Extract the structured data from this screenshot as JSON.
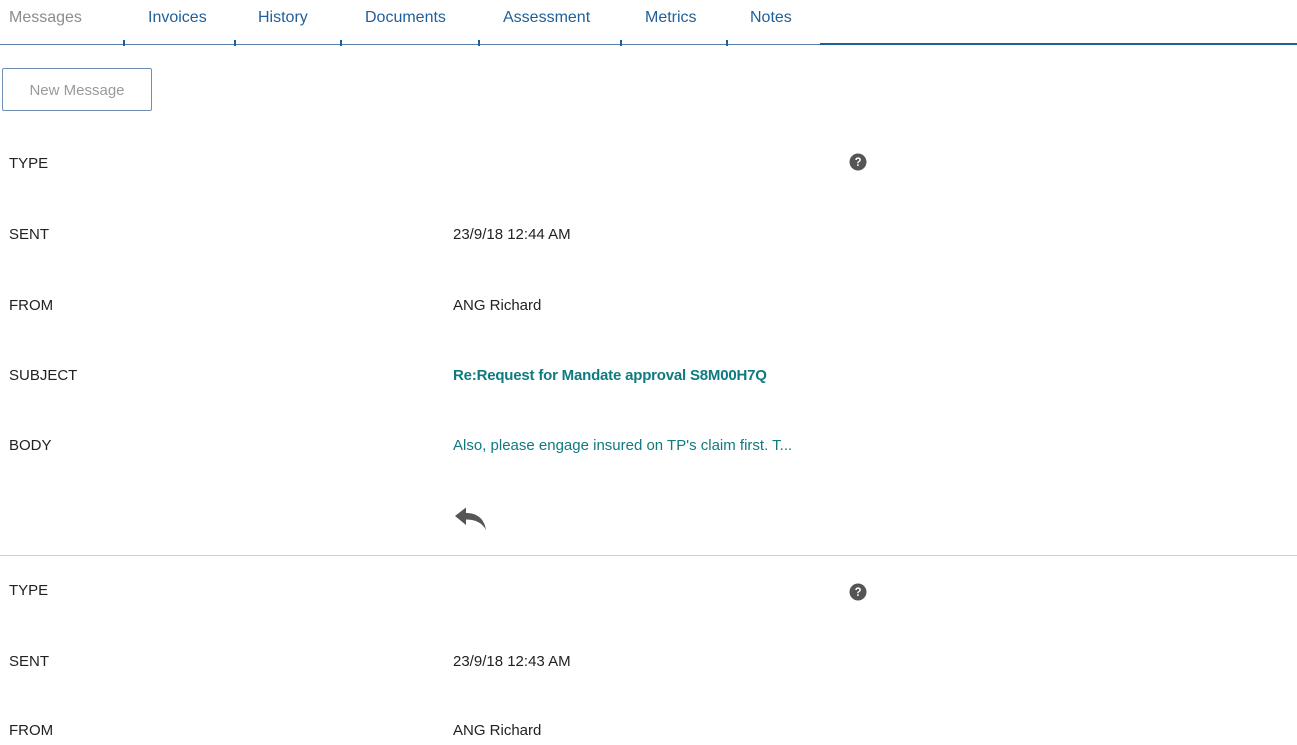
{
  "tabs": [
    {
      "label": "Messages",
      "active": true
    },
    {
      "label": "Invoices",
      "active": false
    },
    {
      "label": "History",
      "active": false
    },
    {
      "label": "Documents",
      "active": false
    },
    {
      "label": "Assessment",
      "active": false
    },
    {
      "label": "Metrics",
      "active": false
    },
    {
      "label": "Notes",
      "active": false
    }
  ],
  "toolbar": {
    "new_message_label": "New Message"
  },
  "messages": [
    {
      "type_label": "TYPE",
      "type_value": "",
      "sent_label": "SENT",
      "sent_value": "23/9/18 12:44 AM",
      "from_label": "FROM",
      "from_value": "ANG Richard",
      "subject_label": "SUBJECT",
      "subject_value": "Re:Request for Mandate approval S8M00H7Q",
      "body_label": "BODY",
      "body_value": "Also, please engage insured on TP's claim first. T..."
    },
    {
      "type_label": "TYPE",
      "type_value": "",
      "sent_label": "SENT",
      "sent_value": "23/9/18 12:43 AM",
      "from_label": "FROM",
      "from_value": "ANG Richard"
    }
  ],
  "icons": {
    "help": "question-circle",
    "reply": "reply-arrow"
  },
  "colors": {
    "tab_link": "#1f5f9a",
    "tab_active": "#8c8c8c",
    "link_teal": "#0f7a80",
    "separator": "#cfcfcf"
  }
}
